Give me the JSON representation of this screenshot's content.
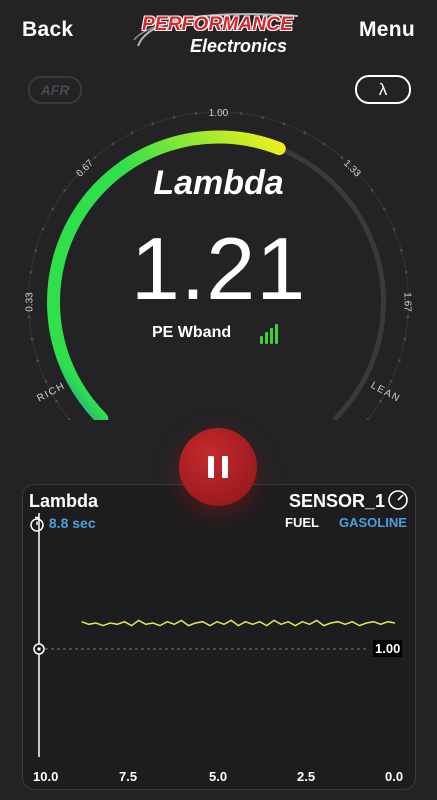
{
  "topbar": {
    "back_label": "Back",
    "menu_label": "Menu",
    "logo_top": "PERFORMANCE",
    "logo_bottom": "Electronics"
  },
  "modes": {
    "afr_label": "AFR",
    "lambda_label": "λ",
    "selected": "lambda"
  },
  "gauge": {
    "title": "Lambda",
    "value": "1.21",
    "sensor_name": "PE Wband",
    "signal_bars": 4,
    "scale_labels": [
      "0.33",
      "0.67",
      "1.00",
      "1.33",
      "1.67"
    ],
    "rich_label": "RICH",
    "lean_label": "LEAN",
    "value_fraction": 0.58,
    "colors": {
      "green": "#2fe04a",
      "yellow": "#f2ef1e",
      "blue": "#1b6fd6",
      "track": "#3a3a3d"
    }
  },
  "controls": {
    "pause_icon": "pause-icon"
  },
  "chart_panel": {
    "title": "Lambda",
    "timer_icon": "stopwatch-icon",
    "timer_text": "8.8 sec",
    "sensor_label": "SENSOR_1",
    "sensor_icon": "gauge-icon",
    "fuel_label": "FUEL",
    "fuel_value": "GASOLINE",
    "reference_label": "1.00"
  },
  "chart_data": {
    "type": "line",
    "x_ticks": [
      "10.0",
      "7.5",
      "5.0",
      "2.5",
      "0.0"
    ],
    "xlim": [
      10.0,
      0.0
    ],
    "reference_y": 1.0,
    "series": [
      {
        "color": "#e6e35c",
        "x": [
          8.8,
          8.6,
          8.4,
          8.2,
          8.0,
          7.8,
          7.6,
          7.4,
          7.2,
          7.0,
          6.8,
          6.6,
          6.4,
          6.2,
          6.0,
          5.8,
          5.6,
          5.4,
          5.2,
          5.0,
          4.8,
          4.6,
          4.4,
          4.2,
          4.0,
          3.8,
          3.6,
          3.4,
          3.2,
          3.0,
          2.8,
          2.6,
          2.4,
          2.2,
          2.0,
          1.8,
          1.6,
          1.4,
          1.2,
          1.0,
          0.8,
          0.6,
          0.4,
          0.2,
          0.0
        ],
        "y": [
          1.21,
          1.19,
          1.2,
          1.18,
          1.2,
          1.19,
          1.21,
          1.18,
          1.22,
          1.19,
          1.2,
          1.18,
          1.21,
          1.19,
          1.22,
          1.18,
          1.2,
          1.21,
          1.18,
          1.21,
          1.19,
          1.22,
          1.18,
          1.21,
          1.19,
          1.21,
          1.18,
          1.22,
          1.19,
          1.21,
          1.18,
          1.21,
          1.19,
          1.22,
          1.18,
          1.2,
          1.21,
          1.19,
          1.21,
          1.18,
          1.2,
          1.21,
          1.19,
          1.21,
          1.2
        ]
      }
    ]
  }
}
